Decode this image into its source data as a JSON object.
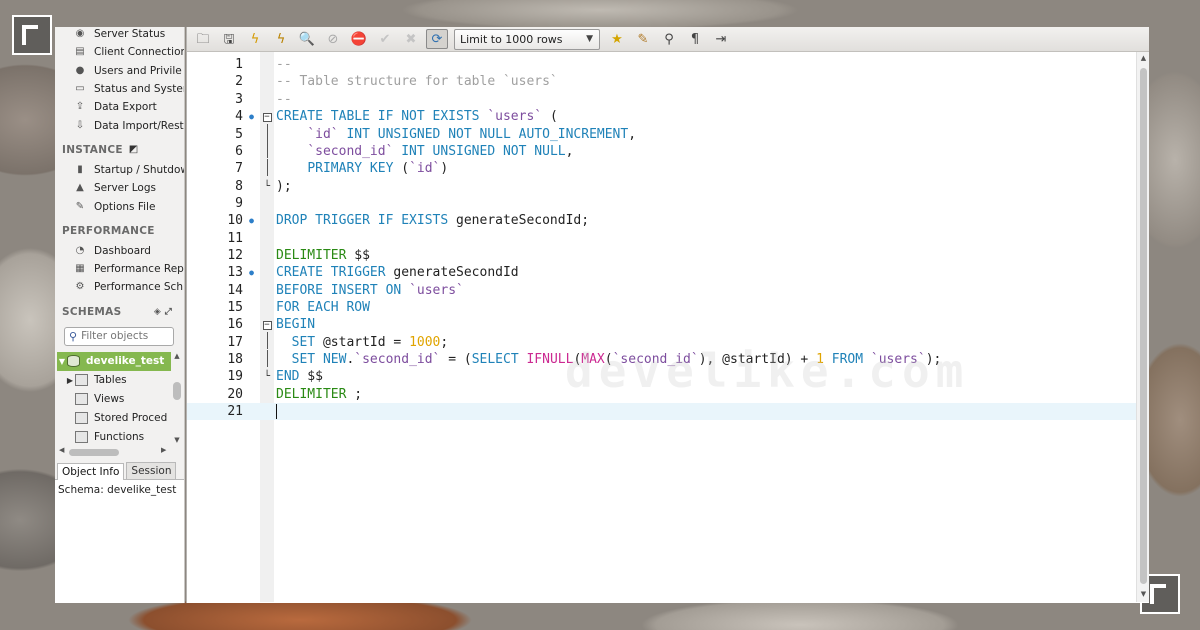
{
  "sidebar": {
    "management_items": [
      {
        "label": "Server Status",
        "icon": "server-status-icon",
        "glyph": "◉"
      },
      {
        "label": "Client Connection",
        "icon": "client-connections-icon",
        "glyph": "▤"
      },
      {
        "label": "Users and Privile",
        "icon": "users-icon",
        "glyph": "●"
      },
      {
        "label": "Status and Syster",
        "icon": "status-variables-icon",
        "glyph": "▭"
      },
      {
        "label": "Data Export",
        "icon": "data-export-icon",
        "glyph": "⇪"
      },
      {
        "label": "Data Import/Resto",
        "icon": "data-import-icon",
        "glyph": "⇩"
      }
    ],
    "instance_header": "INSTANCE",
    "instance_items": [
      {
        "label": "Startup / Shutdow",
        "icon": "startup-icon",
        "glyph": "▮"
      },
      {
        "label": "Server Logs",
        "icon": "server-logs-icon",
        "glyph": "▲"
      },
      {
        "label": "Options File",
        "icon": "options-file-icon",
        "glyph": "✎"
      }
    ],
    "performance_header": "PERFORMANCE",
    "performance_items": [
      {
        "label": "Dashboard",
        "icon": "dashboard-icon",
        "glyph": "◔"
      },
      {
        "label": "Performance Rep",
        "icon": "performance-reports-icon",
        "glyph": "▦"
      },
      {
        "label": "Performance Sch",
        "icon": "performance-schema-icon",
        "glyph": "⚙"
      }
    ],
    "schemas_header": "SCHEMAS",
    "search_placeholder": "Filter objects",
    "tree": {
      "schema": "develike_test",
      "children": [
        "Tables",
        "Views",
        "Stored Proced",
        "Functions"
      ]
    },
    "tabs": [
      "Object Info",
      "Session"
    ],
    "info_text": "Schema: develike_test"
  },
  "toolbar": {
    "limit_select": "Limit to 1000 rows"
  },
  "editor": {
    "line_numbers": [
      "1",
      "2",
      "3",
      "4",
      "5",
      "6",
      "7",
      "8",
      "9",
      "10",
      "11",
      "12",
      "13",
      "14",
      "15",
      "16",
      "17",
      "18",
      "19",
      "20",
      "21"
    ],
    "current_line": 21
  },
  "watermark": "develike.com"
}
